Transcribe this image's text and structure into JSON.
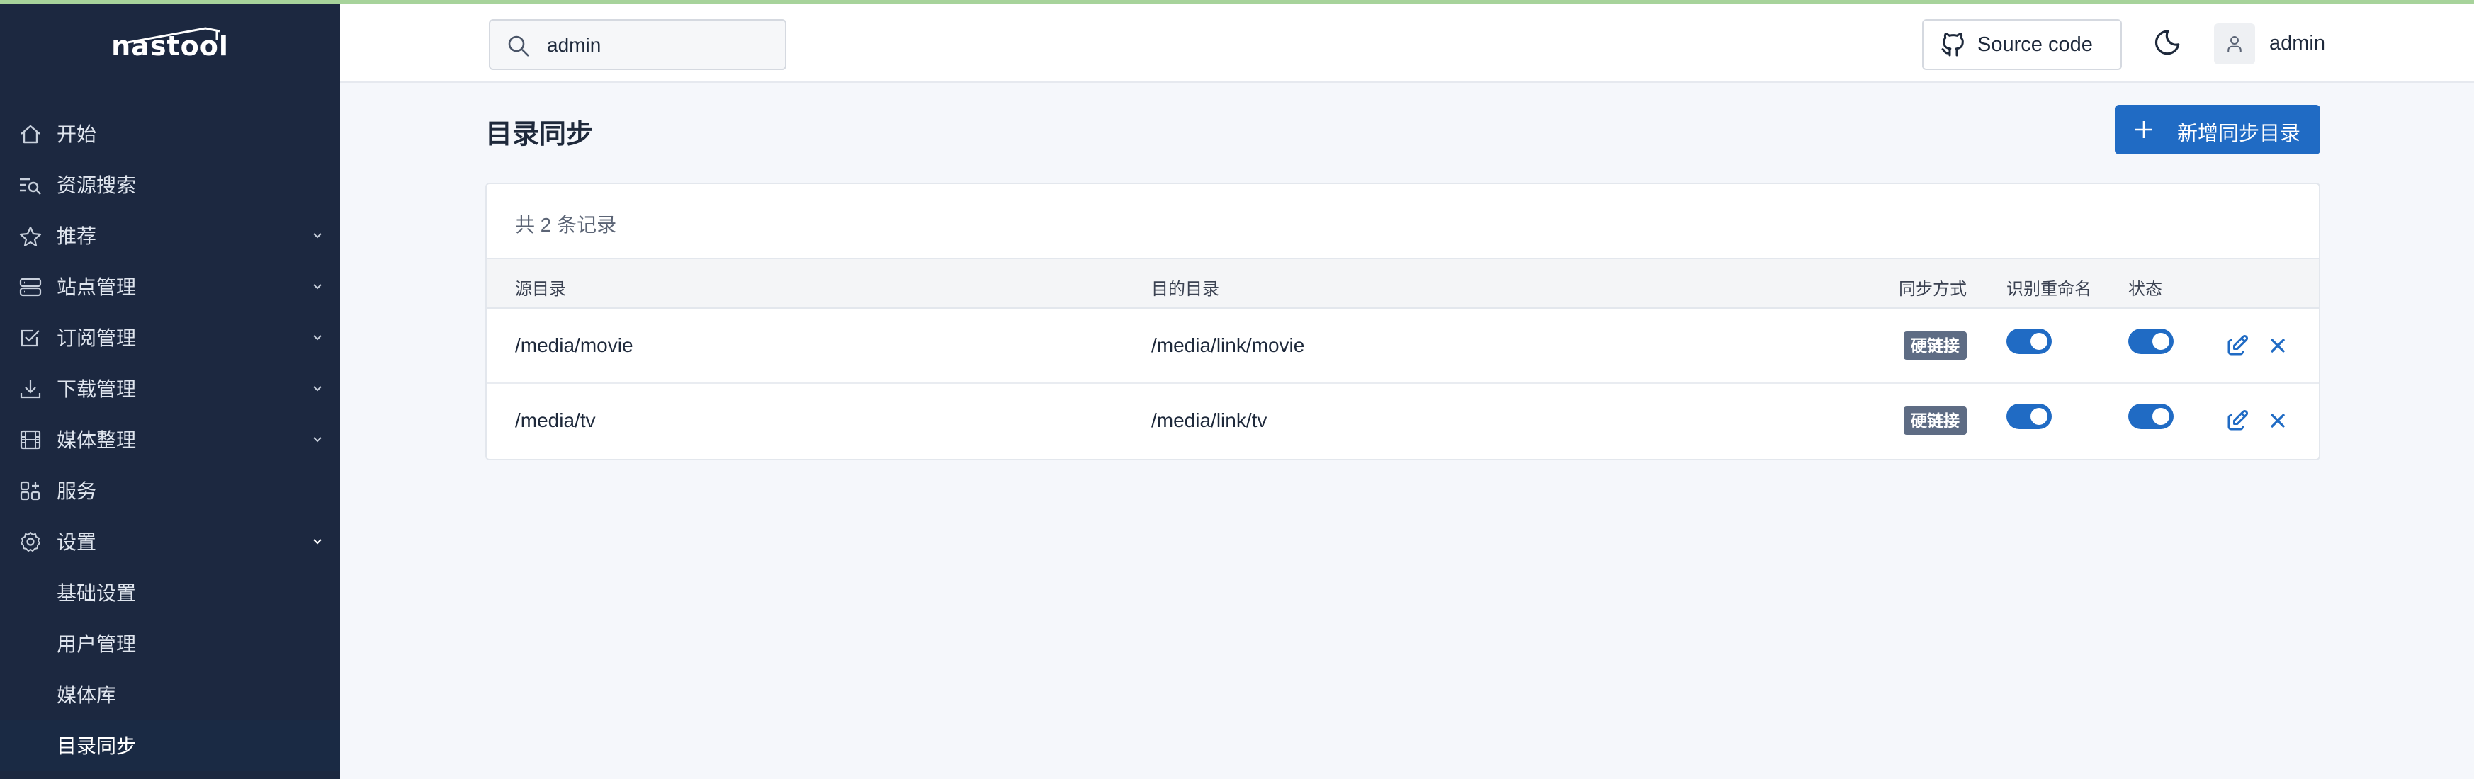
{
  "app": {
    "brand": "nastool"
  },
  "header": {
    "search_value": "admin",
    "source_code_label": "Source code",
    "user_name": "admin"
  },
  "sidebar": {
    "items": [
      {
        "label": "开始",
        "icon": "home-icon",
        "expandable": false
      },
      {
        "label": "资源搜索",
        "icon": "list-search-icon",
        "expandable": false
      },
      {
        "label": "推荐",
        "icon": "star-icon",
        "expandable": true
      },
      {
        "label": "站点管理",
        "icon": "server-icon",
        "expandable": true
      },
      {
        "label": "订阅管理",
        "icon": "checkbox-icon",
        "expandable": true
      },
      {
        "label": "下载管理",
        "icon": "download-icon",
        "expandable": true
      },
      {
        "label": "媒体整理",
        "icon": "film-icon",
        "expandable": true
      },
      {
        "label": "服务",
        "icon": "apps-icon",
        "expandable": false
      },
      {
        "label": "设置",
        "icon": "settings-icon",
        "expandable": true,
        "expanded": true
      }
    ],
    "sub_items": [
      {
        "label": "基础设置"
      },
      {
        "label": "用户管理"
      },
      {
        "label": "媒体库"
      },
      {
        "label": "目录同步",
        "active": true
      }
    ]
  },
  "main": {
    "title": "目录同步",
    "add_button_label": "新增同步目录",
    "record_count": "共 2 条记录",
    "columns": [
      "源目录",
      "目的目录",
      "同步方式",
      "识别重命名",
      "状态"
    ],
    "rows": [
      {
        "source": "/media/movie",
        "target": "/media/link/movie",
        "mode": "硬链接",
        "rename": true,
        "enabled": true
      },
      {
        "source": "/media/tv",
        "target": "/media/link/tv",
        "mode": "硬链接",
        "rename": true,
        "enabled": true
      }
    ]
  },
  "colors": {
    "sidebar_bg": "#1c2840",
    "accent": "#206bc4",
    "badge_bg": "#5e6c84",
    "page_bg": "#f5f7fb"
  }
}
